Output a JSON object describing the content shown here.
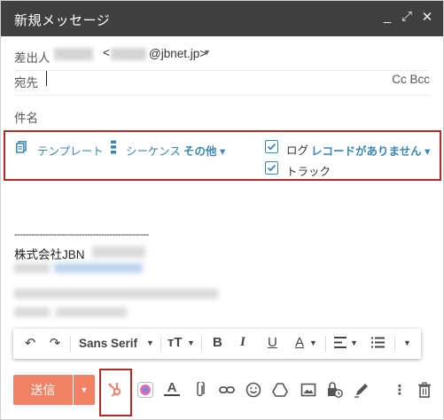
{
  "window": {
    "title": "新規メッセージ",
    "controls": {
      "minimize": "_",
      "popout": "⤢",
      "close": "✕"
    }
  },
  "from": {
    "label": "差出人",
    "open_bracket": "<",
    "email": "@jbnet.jp>",
    "caret": "▼"
  },
  "to": {
    "label": "宛先",
    "cc_bcc": "Cc Bcc"
  },
  "subject": {
    "label": "件名"
  },
  "hubspot": {
    "template_label": "テンプレート",
    "sequence_label": "シーケンス",
    "more_label": "その他 ▾",
    "log_label": "ログ",
    "record_label": "レコードがありません ▾",
    "track_label": "トラック",
    "log_checked": true,
    "track_checked": true,
    "accent_color": "#3a86b4"
  },
  "body": {
    "signature_line": "------------------------------------------------",
    "company": "株式会社JBN"
  },
  "format_toolbar": {
    "undo": "↶",
    "redo": "↷",
    "font": "Sans Serif",
    "size": "тT",
    "bold": "B",
    "italic": "I",
    "underline": "U",
    "text_color": "A"
  },
  "bottom_bar": {
    "send_label": "送信",
    "send_color": "#f08165"
  },
  "highlight_color": "#b32a27"
}
